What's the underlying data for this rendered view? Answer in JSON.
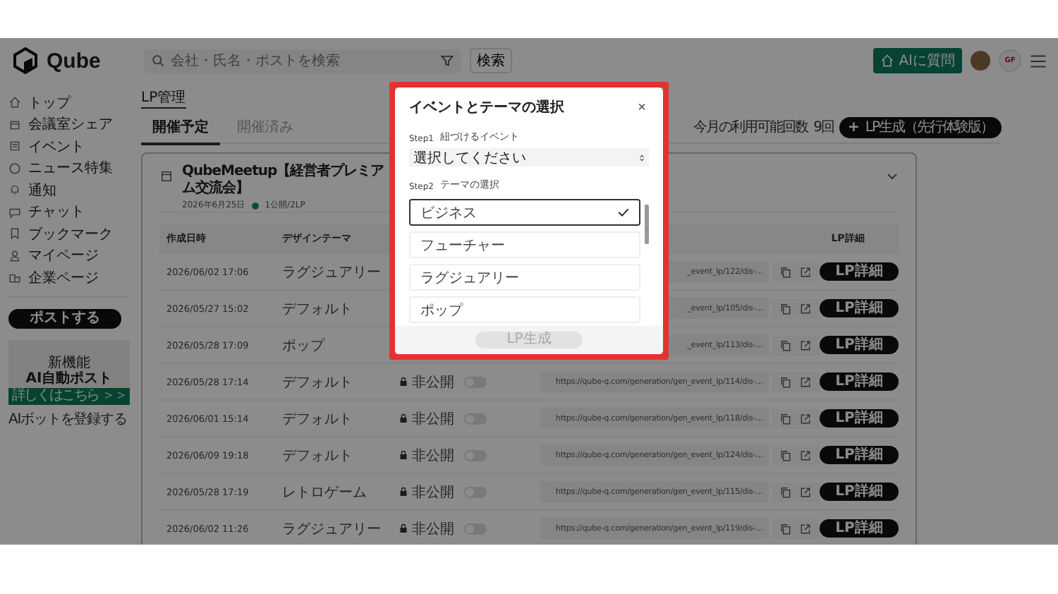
{
  "header": {
    "logo": "Qube",
    "search": {
      "placeholder": "会社・氏名・ポストを検索"
    },
    "search_button": "検索",
    "ai_button": "AIに質問",
    "user_badge": "GF"
  },
  "sidebar": {
    "items": [
      {
        "label": "トップ"
      },
      {
        "label": "会議室シェア"
      },
      {
        "label": "イベント"
      },
      {
        "label": "ニュース特集"
      },
      {
        "label": "通知"
      },
      {
        "label": "チャット"
      },
      {
        "label": "ブックマーク"
      },
      {
        "label": "マイページ"
      },
      {
        "label": "企業ページ"
      }
    ],
    "post_button": "ポストする",
    "banner": {
      "tag": "新機能",
      "title": "AI自動ポスト",
      "link": "詳しくはこちら ＞＞"
    },
    "bot_link": "AIボットを登録する"
  },
  "page": {
    "breadcrumb": "LP管理",
    "tabs": [
      {
        "label": "開催予定",
        "selected": true
      },
      {
        "label": "開催済み",
        "selected": false
      }
    ],
    "quota_label": "今月の利用可能回数",
    "quota_count": "9回",
    "create_button": {
      "icon": "+",
      "label": "LP生成（先行体験版）"
    }
  },
  "event_card": {
    "title": "QubeMeetup【経営者プレミアム交流会】",
    "date": "2026年6月25日",
    "status": "1公開/2LP"
  },
  "table": {
    "columns": [
      {
        "label": "作成日時"
      },
      {
        "label": "デザインテーマ"
      },
      {
        "label": "LP詳細"
      }
    ],
    "rows": [
      {
        "created": "2026/06/02 17:06",
        "theme": "ラグジュアリー",
        "url": "_event_lp/122/dis-…",
        "button": "LP詳細"
      },
      {
        "created": "2026/05/27 15:02",
        "theme": "デフォルト",
        "url": "_event_lp/105/dis-…",
        "button": "LP詳細"
      },
      {
        "created": "2026/05/28 17:09",
        "theme": "ポップ",
        "url": "_event_lp/113/dis-…",
        "button": "LP詳細"
      },
      {
        "created": "2026/05/28 17:14",
        "theme": "デフォルト",
        "status": "非公開",
        "public": false,
        "url": "https://qube-q.com/generation/gen_event_lp/114/dis-…",
        "button": "LP詳細"
      },
      {
        "created": "2026/06/01 15:14",
        "theme": "デフォルト",
        "status": "非公開",
        "public": false,
        "url": "https://qube-q.com/generation/gen_event_lp/118/dis-…",
        "button": "LP詳細"
      },
      {
        "created": "2026/06/09 19:18",
        "theme": "デフォルト",
        "status": "非公開",
        "public": false,
        "url": "https://qube-q.com/generation/gen_event_lp/124/dis-…",
        "button": "LP詳細"
      },
      {
        "created": "2026/05/28 17:19",
        "theme": "レトロゲーム",
        "status": "非公開",
        "public": false,
        "url": "https://qube-q.com/generation/gen_event_lp/115/dis-…",
        "button": "LP詳細"
      },
      {
        "created": "2026/06/02 11:26",
        "theme": "ラグジュアリー",
        "status": "非公開",
        "public": false,
        "url": "https://qube-q.com/generation/gen_event_lp/119/dis-…",
        "button": "LP詳細"
      }
    ]
  },
  "modal": {
    "title": "イベントとテーマの選択",
    "close": "×",
    "step1": {
      "step": "Step1",
      "label": "紐づけるイベント",
      "select": "選択してください"
    },
    "step2": {
      "step": "Step2",
      "label": "テーマの選択",
      "options": [
        {
          "label": "ビジネス",
          "selected": true
        },
        {
          "label": "フューチャー",
          "selected": false
        },
        {
          "label": "ラグジュアリー",
          "selected": false
        },
        {
          "label": "ポップ",
          "selected": false
        }
      ]
    },
    "submit": {
      "label": "LP生成",
      "disabled": true
    }
  }
}
